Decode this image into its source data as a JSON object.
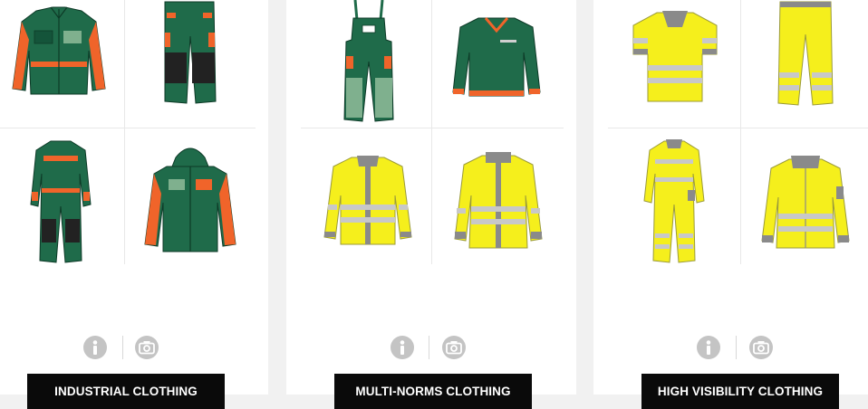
{
  "categories": [
    {
      "label": "INDUSTRIAL CLOTHING",
      "products": [
        {
          "name": "work-jacket",
          "colors": [
            "#1f6b4a",
            "#f0642a"
          ]
        },
        {
          "name": "work-trousers",
          "colors": [
            "#1f6b4a",
            "#f0642a",
            "#222222"
          ]
        },
        {
          "name": "coverall",
          "colors": [
            "#1f6b4a",
            "#f0642a",
            "#222222"
          ]
        },
        {
          "name": "hooded-parka",
          "colors": [
            "#1f6b4a",
            "#f0642a"
          ]
        }
      ]
    },
    {
      "label": "MULTI-NORMS CLOTHING",
      "products": [
        {
          "name": "bib-overall",
          "colors": [
            "#1f6b4a",
            "#7fb08e",
            "#f0642a"
          ]
        },
        {
          "name": "sweater",
          "colors": [
            "#1f6b4a",
            "#f0642a"
          ]
        },
        {
          "name": "hi-vis-shirt",
          "colors": [
            "#f5ef1c",
            "#8a8a8a"
          ]
        },
        {
          "name": "hi-vis-jacket",
          "colors": [
            "#f5ef1c",
            "#8a8a8a"
          ]
        }
      ]
    },
    {
      "label": "HIGH VISIBILITY CLOTHING",
      "products": [
        {
          "name": "hi-vis-polo",
          "colors": [
            "#f5ef1c",
            "#8a8a8a"
          ]
        },
        {
          "name": "hi-vis-trousers",
          "colors": [
            "#f5ef1c",
            "#8a8a8a"
          ]
        },
        {
          "name": "hi-vis-coverall",
          "colors": [
            "#f5ef1c",
            "#8a8a8a"
          ]
        },
        {
          "name": "hi-vis-fleece",
          "colors": [
            "#f5ef1c",
            "#8a8a8a"
          ]
        }
      ]
    }
  ],
  "icons": {
    "info": "info-icon",
    "photo": "camera-icon"
  },
  "colors": {
    "button_bg": "#0a0a0a",
    "button_text": "#ffffff",
    "icon_gray": "#c4c4c4"
  }
}
